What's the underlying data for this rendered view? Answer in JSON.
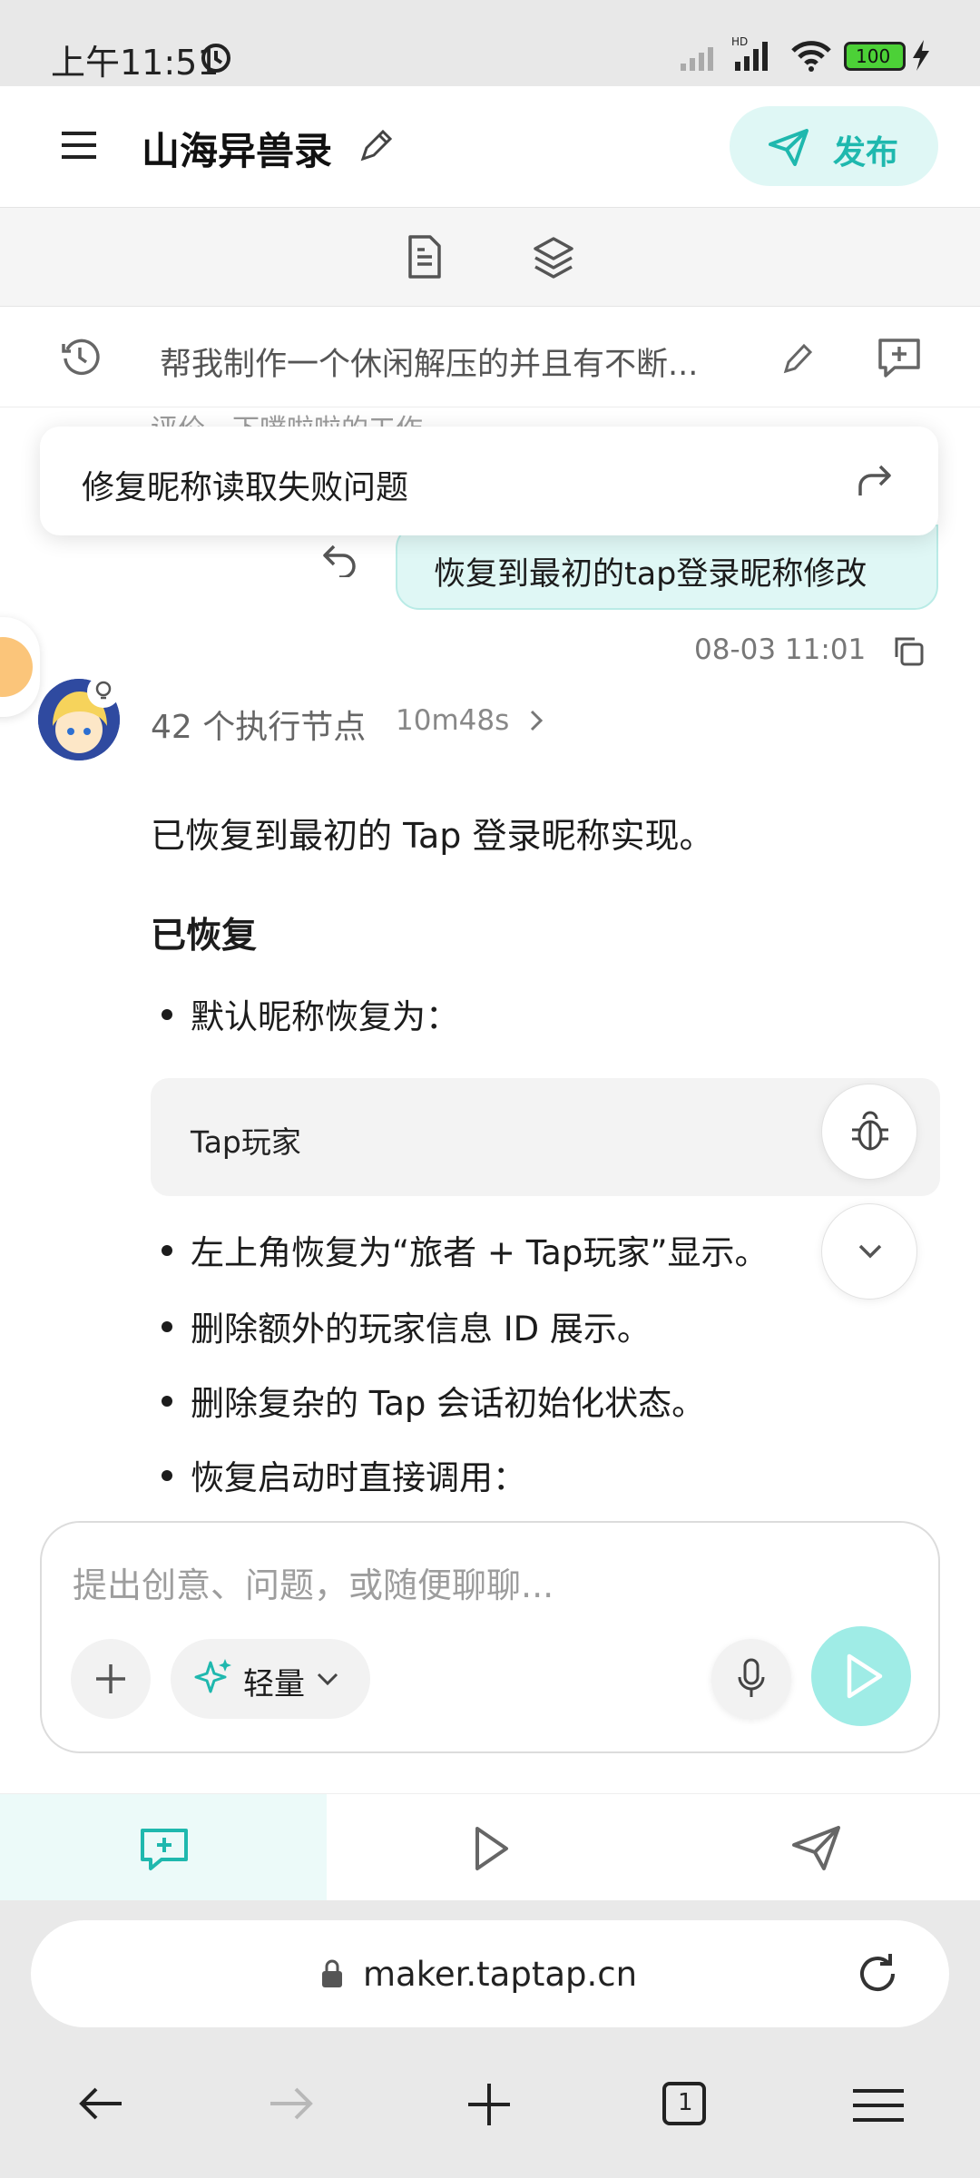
{
  "status_bar": {
    "time": "上午11:51",
    "battery": "100"
  },
  "header": {
    "title": "山海异兽录",
    "publish_label": "发布",
    "accent": "#1fb8ae"
  },
  "prompt_bar": {
    "text": "帮我制作一个休闲解压的并且有不断..."
  },
  "faded_text": "评价，下噗啦啦的工作",
  "floating_card": {
    "text": "修复昵称读取失败问题"
  },
  "user_message": {
    "text": "恢复到最初的tap登录昵称修改",
    "datetime": "08-03 11:01"
  },
  "assistant": {
    "exec_label": "42 个执行节点",
    "exec_time": "10m48s",
    "intro": "已恢复到最初的 Tap 登录昵称实现。",
    "heading": "已恢复",
    "bullets": [
      "默认昵称恢复为：",
      "左上角恢复为“旅者 + Tap玩家”显示。",
      "删除额外的玩家信息 ID 展示。",
      "删除复杂的 Tap 会话初始化状态。",
      "恢复启动时直接调用："
    ],
    "code": "Tap玩家"
  },
  "input": {
    "placeholder": "提出创意、问题，或随便聊聊...",
    "mode_label": "轻量"
  },
  "browser": {
    "url": "maker.taptap.cn",
    "tab_count": "1"
  }
}
